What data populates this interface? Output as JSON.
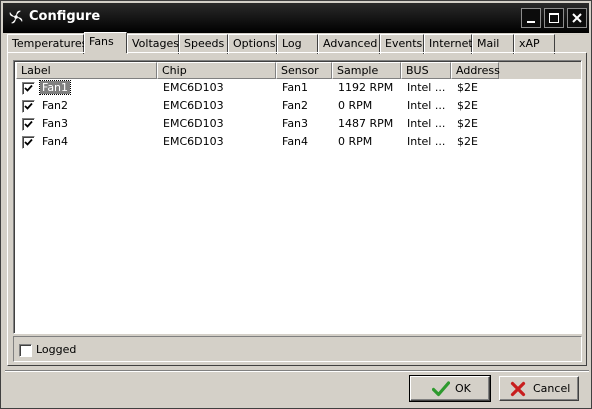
{
  "window": {
    "title": "Configure"
  },
  "tabs": [
    {
      "label": "Temperatures"
    },
    {
      "label": "Fans"
    },
    {
      "label": "Voltages"
    },
    {
      "label": "Speeds"
    },
    {
      "label": "Options"
    },
    {
      "label": "Log"
    },
    {
      "label": "Advanced"
    },
    {
      "label": "Events"
    },
    {
      "label": "Internet"
    },
    {
      "label": "Mail"
    },
    {
      "label": "xAP"
    }
  ],
  "active_tab": "Fans",
  "table": {
    "columns": [
      "Label",
      "Chip",
      "Sensor",
      "Sample",
      "BUS",
      "Address"
    ],
    "rows": [
      {
        "checked": true,
        "label": "Fan1",
        "chip": "EMC6D103",
        "sensor": "Fan1",
        "sample": "1192 RPM",
        "bus": "Intel ...",
        "address": "$2E"
      },
      {
        "checked": true,
        "label": "Fan2",
        "chip": "EMC6D103",
        "sensor": "Fan2",
        "sample": "0 RPM",
        "bus": "Intel ...",
        "address": "$2E"
      },
      {
        "checked": true,
        "label": "Fan3",
        "chip": "EMC6D103",
        "sensor": "Fan3",
        "sample": "1487 RPM",
        "bus": "Intel ...",
        "address": "$2E"
      },
      {
        "checked": true,
        "label": "Fan4",
        "chip": "EMC6D103",
        "sensor": "Fan4",
        "sample": "0 RPM",
        "bus": "Intel ...",
        "address": "$2E"
      }
    ]
  },
  "logged": {
    "label": "Logged",
    "checked": false
  },
  "buttons": {
    "ok": "OK",
    "cancel": "Cancel"
  },
  "colors": {
    "ok_check": "#2e9a2e",
    "cancel_x": "#c81e1e",
    "selection": "#808080"
  }
}
